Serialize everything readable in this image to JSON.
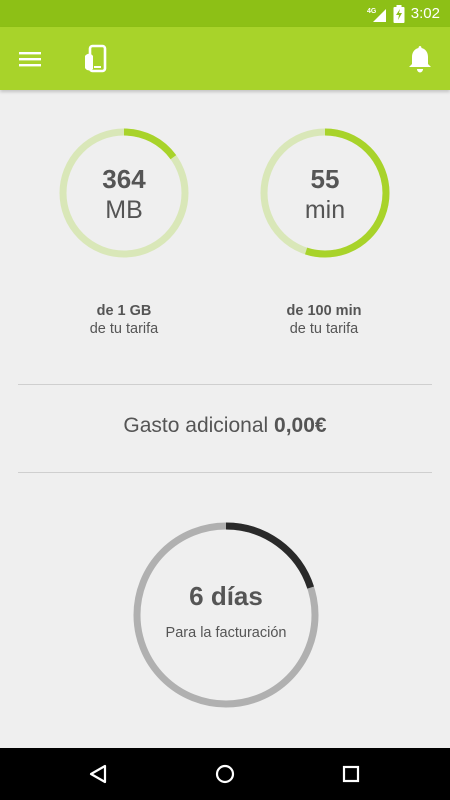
{
  "status_bar": {
    "network": "4G",
    "time": "3:02",
    "icons": [
      "signal-icon",
      "battery-charging-icon"
    ]
  },
  "app_bar": {
    "icons": [
      "menu-icon",
      "phone-icon",
      "bell-icon"
    ]
  },
  "data_usage": {
    "value": "364",
    "unit": "MB",
    "caption_strong": "de 1 GB",
    "caption": "de tu tarifa",
    "fill_fraction": 0.15
  },
  "minutes_usage": {
    "value": "55",
    "unit": "min",
    "caption_strong": "de 100 min",
    "caption": "de tu tarifa",
    "fill_fraction": 0.55
  },
  "extra_cost": {
    "label": "Gasto adicional",
    "amount": "0,00€"
  },
  "billing": {
    "value": "6 días",
    "label": "Para la facturación",
    "fill_fraction": 0.2
  },
  "nav_bar": {
    "icons": [
      "back-icon",
      "home-icon",
      "recents-icon"
    ]
  },
  "colors": {
    "status_bar": "#8dc016",
    "app_bar": "#a8d32a",
    "ring_track": "#d9e7b8",
    "ring_fill": "#a8d32a",
    "billing_track": "#b0b0b0",
    "billing_fill": "#2a2a2a",
    "background": "#efefef"
  }
}
